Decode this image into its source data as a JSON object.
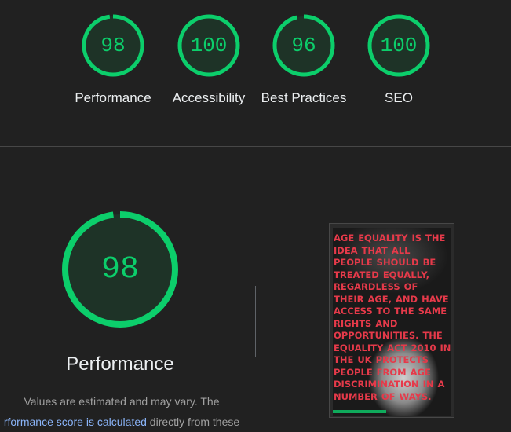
{
  "summary": {
    "gauges": [
      {
        "label": "Performance",
        "score": "98",
        "value": 0.98
      },
      {
        "label": "Accessibility",
        "score": "100",
        "value": 1.0
      },
      {
        "label": "Best Practices",
        "score": "96",
        "value": 0.96
      },
      {
        "label": "SEO",
        "score": "100",
        "value": 1.0
      }
    ]
  },
  "performance": {
    "score": "98",
    "value": 0.98,
    "title": "Performance",
    "note_prefix": "Values are estimated and may vary. The",
    "note_link": "rformance score is calculated",
    "note_suffix": " directly from these"
  },
  "screenshot": {
    "text": "Age equality is the idea that all people should be treated equally, regardless of their age, and have access to the same rights and opportunities. The Equality Act 2010 in the UK protects people from age discrimination in a number of ways."
  },
  "colors": {
    "pass": "#0cce6b",
    "gauge_bg": "#1f3a2a",
    "link": "#8ab4f8"
  }
}
